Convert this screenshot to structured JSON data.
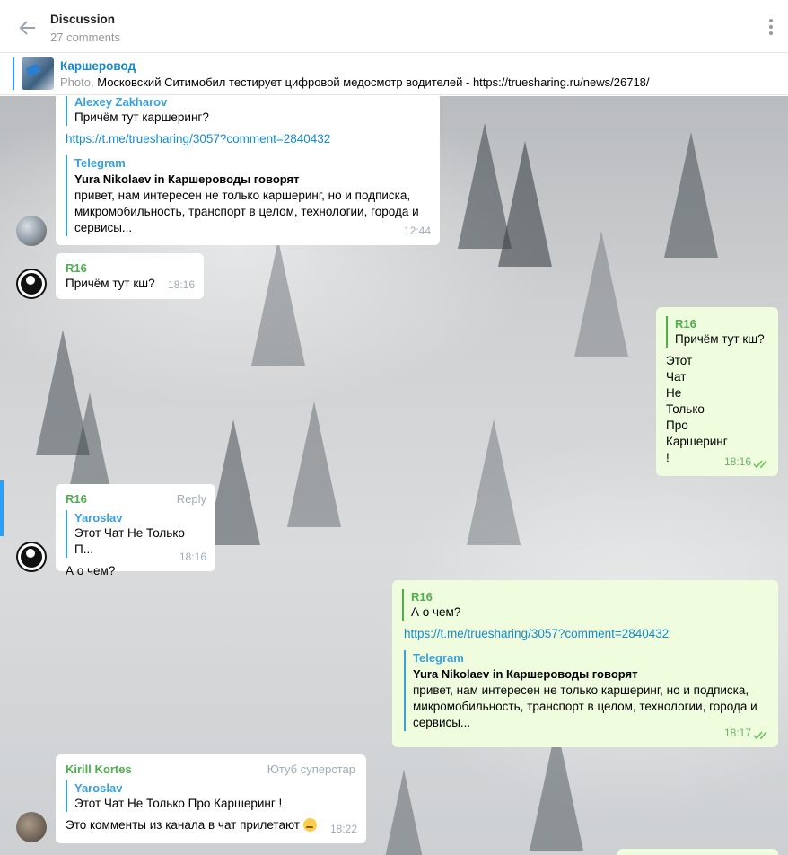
{
  "header": {
    "title": "Discussion",
    "subtitle": "27 comments"
  },
  "pinned": {
    "name": "Каршеровод",
    "prefix": "Photo,",
    "text": "Московский Ситимобил тестирует цифровой медосмотр водителей - https://truesharing.ru/news/26718/"
  },
  "messages": [
    {
      "reply_name": "Alexey Zakharov",
      "reply_text": "Причём тут каршеринг?",
      "link": "https://t.me/truesharing/3057?comment=2840432",
      "preview_site": "Telegram",
      "preview_title": "Yura Nikolaev in Каршероводы говорят",
      "preview_text": "привет, нам интересен не только каршеринг, но и подписка, микромобильность, транспорт в целом, технологии, города и сервисы...",
      "time": "12:44"
    },
    {
      "sender": "R16",
      "text": "Причём тут кш?",
      "time": "18:16"
    },
    {
      "reply_name": "R16",
      "reply_text": "Причём тут кш?",
      "lines": [
        "Этот",
        "Чат",
        "Не",
        "Только",
        "Про",
        "Каршеринг",
        "!"
      ],
      "time": "18:16"
    },
    {
      "sender": "R16",
      "action": "Reply",
      "reply_name": "Yaroslav",
      "reply_text": "Этот Чат Не Только П...",
      "text": "А о чем?",
      "time": "18:16"
    },
    {
      "reply_name": "R16",
      "reply_text": "А о чем?",
      "link": "https://t.me/truesharing/3057?comment=2840432",
      "preview_site": "Telegram",
      "preview_title": "Yura Nikolaev in Каршероводы говорят",
      "preview_line1": "привет, нам интересен не только каршеринг, но и подписка,",
      "preview_line2": "микромобильность, транспорт в целом, технологии, города и",
      "preview_line3": "сервисы...",
      "time": "18:17"
    },
    {
      "sender": "Kirill Kortes",
      "badge": "Ютуб суперстар",
      "reply_name": "Yaroslav",
      "reply_text": "Этот Чат Не Только Про Каршеринг !",
      "text": "Это комменты из канала в чат прилетают",
      "time": "18:22"
    }
  ],
  "colors": {
    "accent": "#168acd",
    "sender_green": "#4fae4e",
    "outgoing_bg": "#effdde"
  }
}
